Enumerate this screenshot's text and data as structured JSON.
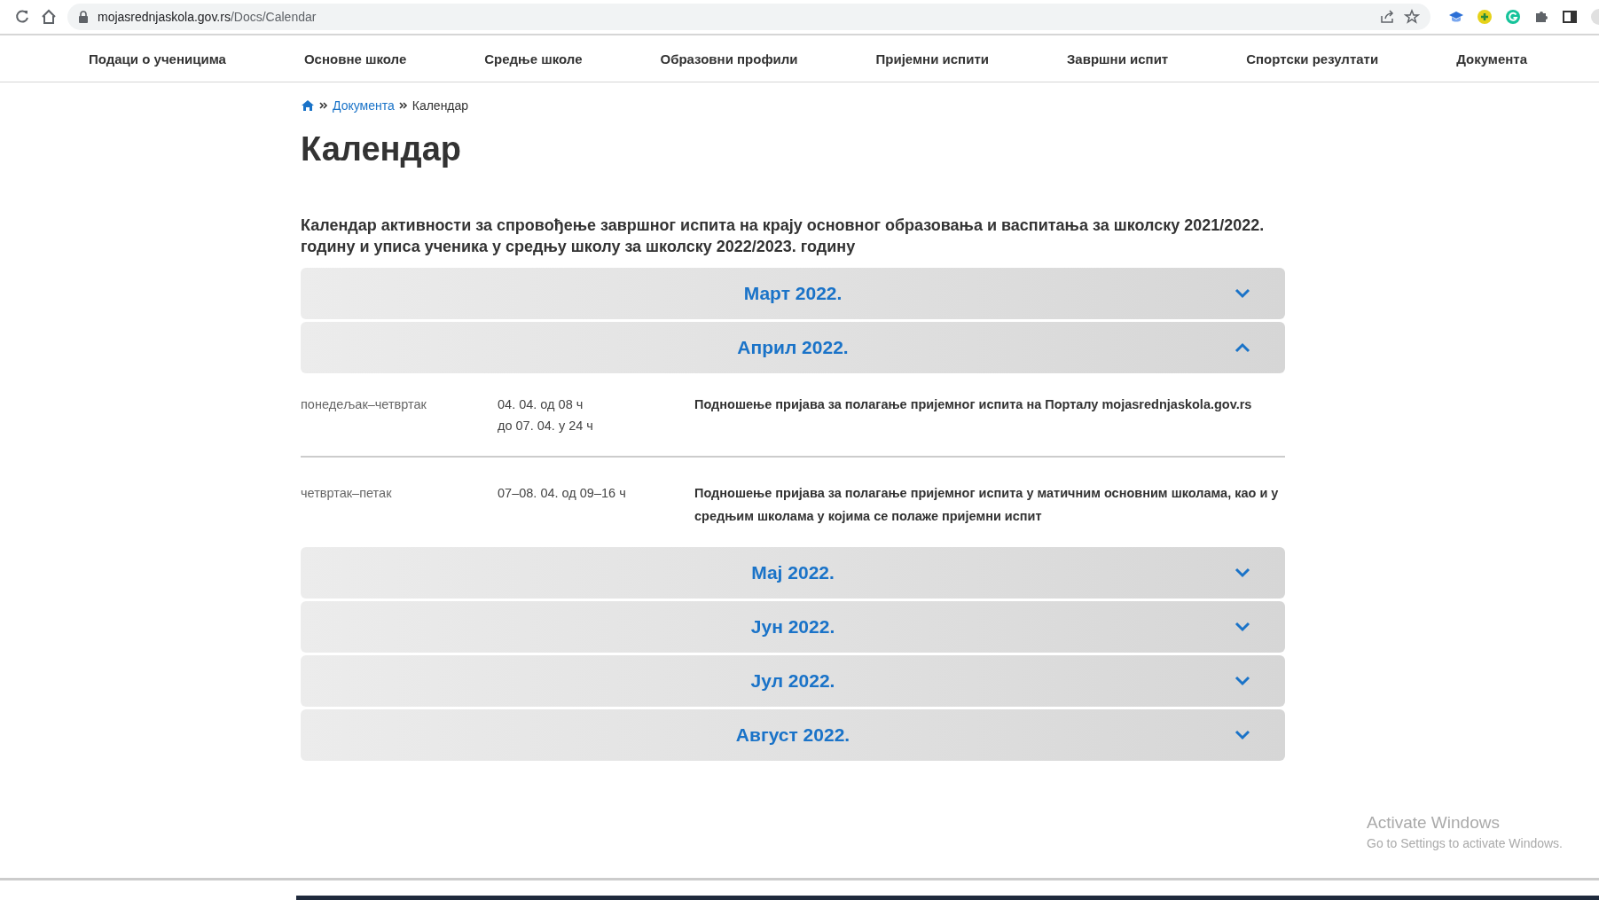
{
  "browser": {
    "url_host": "mojasrednjaskola.gov.rs",
    "url_path": "/Docs/Calendar"
  },
  "nav": [
    "Подаци о ученицима",
    "Основне школе",
    "Средње школе",
    "Образовни профили",
    "Пријемни испити",
    "Завршни испит",
    "Спортски резултати",
    "Документа"
  ],
  "breadcrumb": {
    "link": "Документа",
    "current": "Календар"
  },
  "title": "Календар",
  "description": "Календар активности за спровођење завршног испита на крају основног образовања и васпитања за школску 2021/2022. годину и уписа ученика у средњу школу за школску 2022/2023. годину",
  "months": [
    {
      "label": "Март 2022.",
      "expanded": false
    },
    {
      "label": "Април 2022.",
      "expanded": true,
      "entries": [
        {
          "days": "понедељак–четвртак",
          "time_lines": [
            "04. 04. од 08 ч",
            "до 07. 04. у 24 ч"
          ],
          "description": "Подношење пријава за полагање пријемног испита на Порталу mojasrednjaskola.gov.rs"
        },
        {
          "days": "четвртак–петак",
          "time_lines": [
            "07–08. 04. од 09–16 ч"
          ],
          "description": "Подношење пријава за полагање пријемног испита у матичним основним школама, као и у средњим школама у којима се полаже пријемни испит"
        }
      ]
    },
    {
      "label": "Мај 2022.",
      "expanded": false
    },
    {
      "label": "Јун 2022.",
      "expanded": false
    },
    {
      "label": "Јул 2022.",
      "expanded": false
    },
    {
      "label": "Август 2022.",
      "expanded": false
    }
  ],
  "activation": {
    "title": "Activate Windows",
    "subtitle": "Go to Settings to activate Windows."
  }
}
